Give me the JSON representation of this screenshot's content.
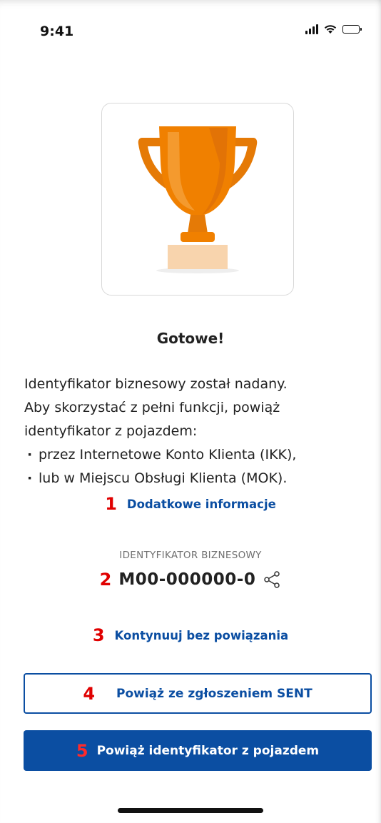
{
  "status_bar": {
    "time": "9:41"
  },
  "colors": {
    "accent": "#0b4ea2",
    "annotation": "#e00000",
    "trophy": "#f08000",
    "trophy_base": "#f8d4ad"
  },
  "illustration": {
    "icon": "trophy-icon"
  },
  "result": {
    "title": "Gotowe!",
    "description_lines": [
      "Identyfikator biznesowy został nadany.",
      "Aby skorzystać z pełni funkcji, powiąż",
      "identyfikator z pojazdem:"
    ],
    "bullets": [
      "przez Internetowe Konto Klienta (IKK),",
      "lub w Miejscu Obsługi Klienta (MOK)."
    ]
  },
  "annotations": {
    "n1": "1",
    "n2": "2",
    "n3": "3",
    "n4": "4",
    "n5": "5"
  },
  "more_info_link": "Dodatkowe informacje",
  "identifier": {
    "label": "IDENTYFIKATOR BIZNESOWY",
    "value": "M00-000000-0",
    "share_icon": "share-icon"
  },
  "continue_link": "Kontynuuj bez powiązania",
  "buttons": {
    "link_sent": "Powiąż ze zgłoszeniem SENT",
    "link_vehicle": "Powiąż identyfikator z pojazdem"
  }
}
